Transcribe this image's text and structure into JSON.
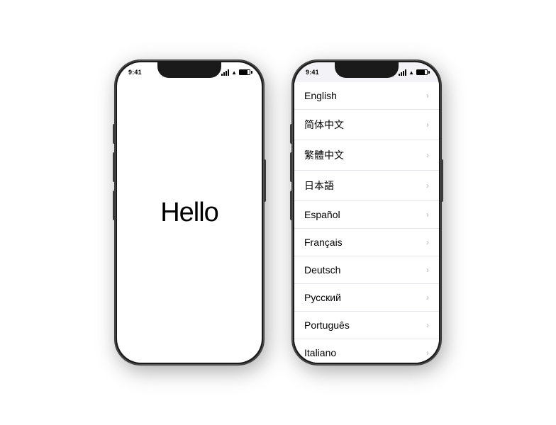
{
  "phone1": {
    "status_bar": {
      "time": "9:41",
      "signal": [
        3,
        5,
        7,
        9,
        11
      ],
      "wifi": "WiFi",
      "battery": 80
    },
    "screen": {
      "hello_text": "Hello"
    }
  },
  "phone2": {
    "status_bar": {
      "time": "9:41",
      "signal": [
        3,
        5,
        7,
        9,
        11
      ],
      "wifi": "WiFi",
      "battery": 80
    },
    "languages": [
      {
        "name": "English",
        "id": "english"
      },
      {
        "name": "简体中文",
        "id": "simplified-chinese"
      },
      {
        "name": "繁體中文",
        "id": "traditional-chinese"
      },
      {
        "name": "日本語",
        "id": "japanese"
      },
      {
        "name": "Español",
        "id": "spanish"
      },
      {
        "name": "Français",
        "id": "french"
      },
      {
        "name": "Deutsch",
        "id": "german"
      },
      {
        "name": "Русский",
        "id": "russian"
      },
      {
        "name": "Português",
        "id": "portuguese"
      },
      {
        "name": "Italiano",
        "id": "italian"
      }
    ]
  }
}
